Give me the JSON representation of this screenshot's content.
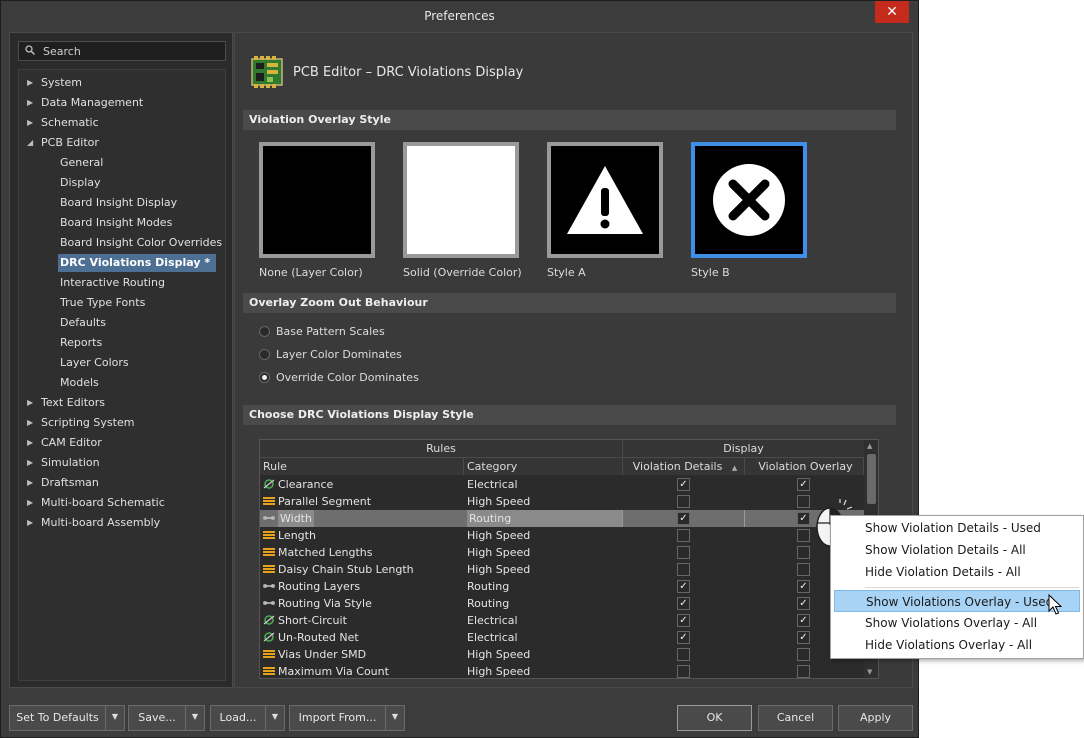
{
  "window": {
    "title": "Preferences",
    "close_glyph": "✕"
  },
  "search": {
    "placeholder": "Search",
    "icon": "search-icon"
  },
  "tree": {
    "items": [
      {
        "label": "System",
        "level": 0,
        "expanded": false
      },
      {
        "label": "Data Management",
        "level": 0,
        "expanded": false
      },
      {
        "label": "Schematic",
        "level": 0,
        "expanded": false
      },
      {
        "label": "PCB Editor",
        "level": 0,
        "expanded": true
      },
      {
        "label": "General",
        "level": 1
      },
      {
        "label": "Display",
        "level": 1
      },
      {
        "label": "Board Insight Display",
        "level": 1
      },
      {
        "label": "Board Insight Modes",
        "level": 1
      },
      {
        "label": "Board Insight Color Overrides",
        "level": 1
      },
      {
        "label": "DRC Violations Display *",
        "level": 1,
        "selected": true
      },
      {
        "label": "Interactive Routing",
        "level": 1
      },
      {
        "label": "True Type Fonts",
        "level": 1
      },
      {
        "label": "Defaults",
        "level": 1
      },
      {
        "label": "Reports",
        "level": 1
      },
      {
        "label": "Layer Colors",
        "level": 1
      },
      {
        "label": "Models",
        "level": 1
      },
      {
        "label": "Text Editors",
        "level": 0,
        "expanded": false
      },
      {
        "label": "Scripting System",
        "level": 0,
        "expanded": false
      },
      {
        "label": "CAM Editor",
        "level": 0,
        "expanded": false
      },
      {
        "label": "Simulation",
        "level": 0,
        "expanded": false
      },
      {
        "label": "Draftsman",
        "level": 0,
        "expanded": false
      },
      {
        "label": "Multi-board Schematic",
        "level": 0,
        "expanded": false
      },
      {
        "label": "Multi-board Assembly",
        "level": 0,
        "expanded": false
      }
    ]
  },
  "page": {
    "title": "PCB Editor – DRC Violations Display",
    "icon": "pcb-board-icon"
  },
  "overlay_style": {
    "header": "Violation Overlay Style",
    "options": [
      {
        "label": "None (Layer Color)",
        "icon": "black-fill"
      },
      {
        "label": "Solid (Override Color)",
        "icon": "white-fill"
      },
      {
        "label": "Style A",
        "icon": "warning-triangle-icon"
      },
      {
        "label": "Style B",
        "icon": "x-circle-icon",
        "selected": true
      }
    ]
  },
  "zoom_behaviour": {
    "header": "Overlay Zoom Out Behaviour",
    "options": [
      {
        "label": "Base Pattern Scales",
        "checked": false
      },
      {
        "label": "Layer Color Dominates",
        "checked": false
      },
      {
        "label": "Override Color Dominates",
        "checked": true
      }
    ]
  },
  "display_style": {
    "header": "Choose DRC Violations Display Style",
    "group_headers": {
      "rules": "Rules",
      "display": "Display"
    },
    "columns": {
      "rule": "Rule",
      "category": "Category",
      "details": "Violation Details",
      "overlay": "Violation Overlay"
    },
    "rows": [
      {
        "rule": "Clearance",
        "category": "Electrical",
        "details": true,
        "overlay": true,
        "icon": "electrical-rule-icon"
      },
      {
        "rule": "Parallel Segment",
        "category": "High Speed",
        "details": false,
        "overlay": false,
        "icon": "highspeed-rule-icon"
      },
      {
        "rule": "Width",
        "category": "Routing",
        "details": true,
        "overlay": true,
        "icon": "routing-rule-icon",
        "highlighted": true
      },
      {
        "rule": "Length",
        "category": "High Speed",
        "details": false,
        "overlay": false,
        "icon": "highspeed-rule-icon"
      },
      {
        "rule": "Matched Lengths",
        "category": "High Speed",
        "details": false,
        "overlay": false,
        "icon": "highspeed-rule-icon"
      },
      {
        "rule": "Daisy Chain Stub Length",
        "category": "High Speed",
        "details": false,
        "overlay": false,
        "icon": "highspeed-rule-icon"
      },
      {
        "rule": "Routing Layers",
        "category": "Routing",
        "details": true,
        "overlay": true,
        "icon": "routing-rule-icon"
      },
      {
        "rule": "Routing Via Style",
        "category": "Routing",
        "details": true,
        "overlay": true,
        "icon": "routing-rule-icon"
      },
      {
        "rule": "Short-Circuit",
        "category": "Electrical",
        "details": true,
        "overlay": true,
        "icon": "electrical-rule-icon"
      },
      {
        "rule": "Un-Routed Net",
        "category": "Electrical",
        "details": true,
        "overlay": true,
        "icon": "electrical-rule-icon"
      },
      {
        "rule": "Vias Under SMD",
        "category": "High Speed",
        "details": false,
        "overlay": false,
        "icon": "highspeed-rule-icon"
      },
      {
        "rule": "Maximum Via Count",
        "category": "High Speed",
        "details": false,
        "overlay": false,
        "icon": "highspeed-rule-icon"
      }
    ]
  },
  "context_menu": {
    "items": [
      {
        "label": "Show Violation Details - Used"
      },
      {
        "label": "Show Violation Details - All"
      },
      {
        "label": "Hide Violation Details - All"
      },
      {
        "label": "Show Violations Overlay - Used",
        "highlighted": true
      },
      {
        "label": "Show Violations Overlay - All"
      },
      {
        "label": "Hide Violations Overlay - All"
      }
    ]
  },
  "footer": {
    "set_defaults": "Set To Defaults",
    "save": "Save...",
    "load": "Load...",
    "import": "Import From...",
    "ok": "OK",
    "cancel": "Cancel",
    "apply": "Apply",
    "dropdown_glyph": "▼"
  },
  "colors": {
    "selection_blue": "#3d8fe8",
    "tree_selection": "#4c6f93",
    "menu_highlight": "#a8d3f5",
    "close_red": "#c42b1c"
  }
}
